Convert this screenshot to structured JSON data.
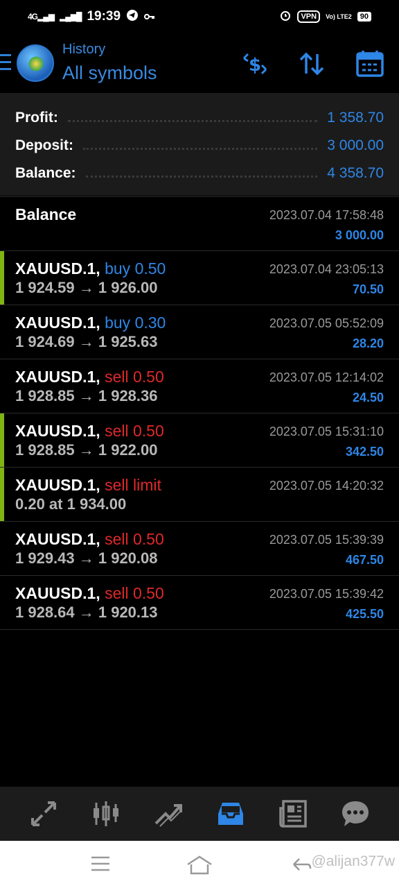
{
  "status_bar": {
    "network_left": "4G",
    "network_right": "4G",
    "time": "19:39",
    "icons": [
      "telegram-icon",
      "key-icon",
      "alarm-icon"
    ],
    "vpn": "VPN",
    "volte": "Vo) LTE2",
    "battery": "90"
  },
  "header": {
    "subtitle": "History",
    "title": "All symbols",
    "icons": [
      "menu-icon",
      "app-logo",
      "dollar-swap-icon",
      "sort-icon",
      "calendar-icon"
    ]
  },
  "summary": {
    "profit_label": "Profit:",
    "profit_value": "1 358.70",
    "deposit_label": "Deposit:",
    "deposit_value": "3 000.00",
    "balance_label": "Balance:",
    "balance_value": "4 358.70"
  },
  "balance_entry": {
    "title": "Balance",
    "time": "2023.07.04 17:58:48",
    "amount": "3 000.00"
  },
  "trades": [
    {
      "symbol": "XAUUSD.1,",
      "action": "buy 0.50",
      "side": "buy",
      "prices": "1 924.59 → 1 926.00",
      "time": "2023.07.04 23:05:13",
      "profit": "70.50",
      "marker": true
    },
    {
      "symbol": "XAUUSD.1,",
      "action": "buy 0.30",
      "side": "buy",
      "prices": "1 924.69 → 1 925.63",
      "time": "2023.07.05 05:52:09",
      "profit": "28.20",
      "marker": false
    },
    {
      "symbol": "XAUUSD.1,",
      "action": "sell 0.50",
      "side": "sell",
      "prices": "1 928.85 → 1 928.36",
      "time": "2023.07.05 12:14:02",
      "profit": "24.50",
      "marker": false
    },
    {
      "symbol": "XAUUSD.1,",
      "action": "sell 0.50",
      "side": "sell",
      "prices": "1 928.85 → 1 922.00",
      "time": "2023.07.05 15:31:10",
      "profit": "342.50",
      "marker": true
    },
    {
      "symbol": "XAUUSD.1,",
      "action": "sell limit",
      "side": "sell",
      "prices": "0.20 at 1 934.00",
      "time": "2023.07.05 14:20:32",
      "profit": "",
      "marker": true
    },
    {
      "symbol": "XAUUSD.1,",
      "action": "sell 0.50",
      "side": "sell",
      "prices": "1 929.43 → 1 920.08",
      "time": "2023.07.05 15:39:39",
      "profit": "467.50",
      "marker": false
    },
    {
      "symbol": "XAUUSD.1,",
      "action": "sell 0.50",
      "side": "sell",
      "prices": "1 928.64 → 1 920.13",
      "time": "2023.07.05 15:39:42",
      "profit": "425.50",
      "marker": false
    }
  ],
  "bottom_nav": {
    "items": [
      "quotes-icon",
      "chart-icon",
      "trade-icon",
      "history-icon",
      "news-icon",
      "chat-icon"
    ],
    "active": "history-icon",
    "active_color": "#2e86e6"
  },
  "system_nav": {
    "watermark": "@alijan377w"
  },
  "colors": {
    "accent": "#2e86e6",
    "sell": "#e02828",
    "marker": "#7fb413"
  }
}
